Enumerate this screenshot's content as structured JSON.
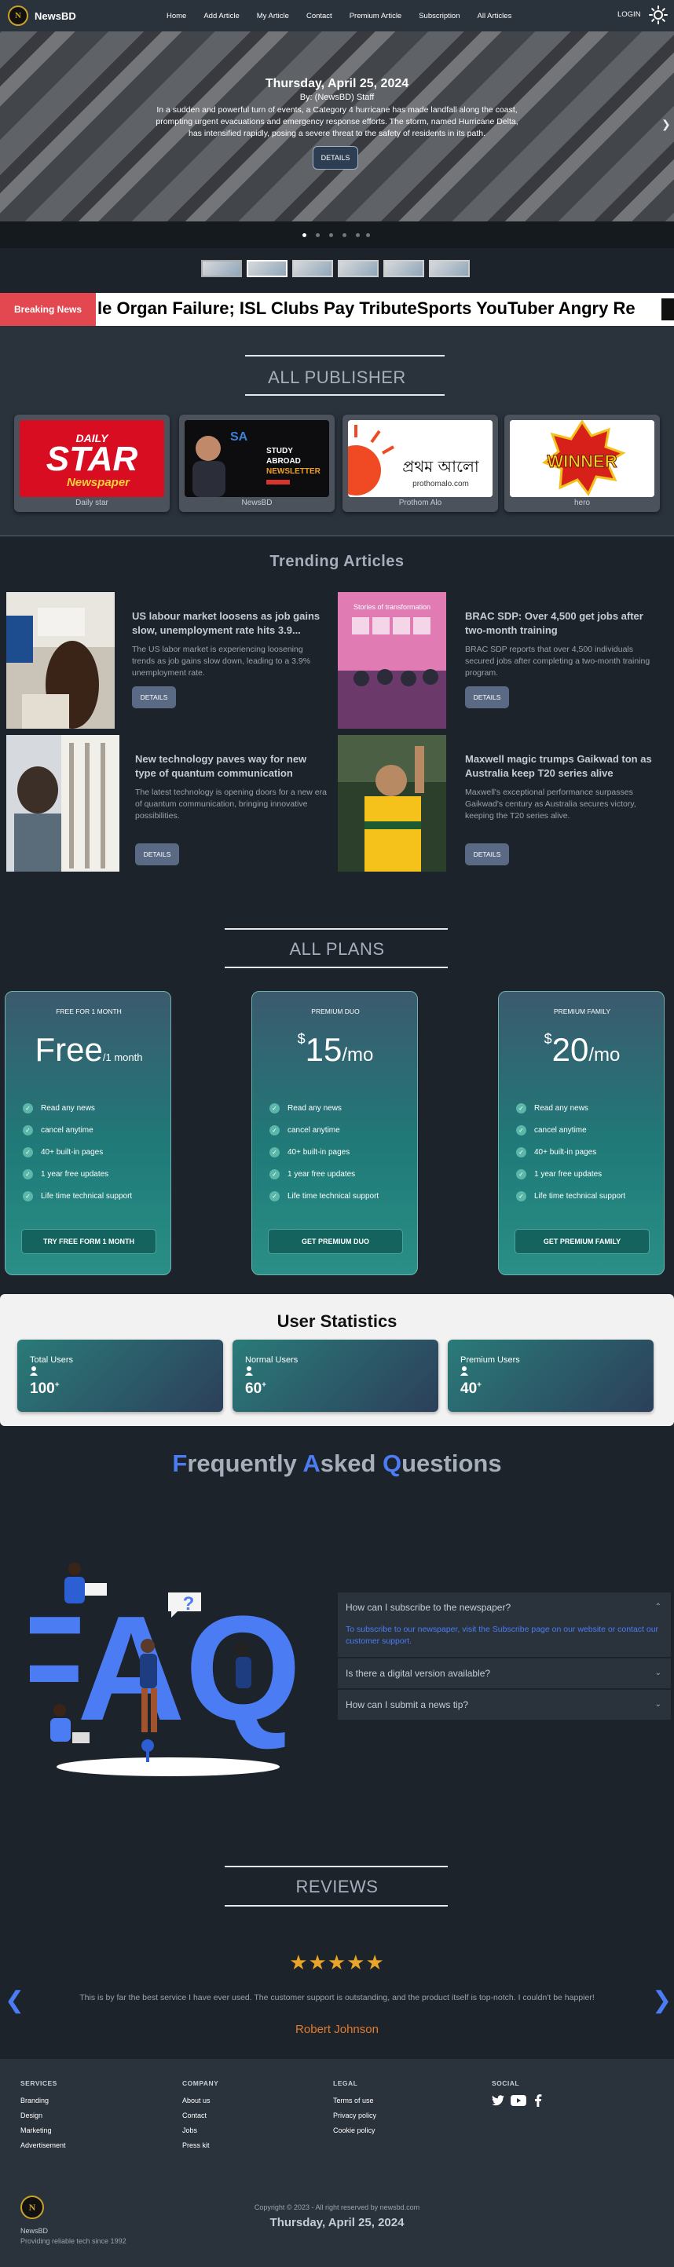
{
  "nav": {
    "logo_letter": "N",
    "brand": "NewsBD",
    "links": [
      "Home",
      "Add Article",
      "My Article",
      "Contact",
      "Premium Article",
      "Subscription",
      "All Articles"
    ],
    "login": "LOGIN",
    "theme_icon": "sun-icon"
  },
  "hero": {
    "date": "Thursday, April 25, 2024",
    "byline": "By: (NewsBD) Staff",
    "text": "In a sudden and powerful turn of events, a Category 4 hurricane has made landfall along the coast, prompting urgent evacuations and emergency response efforts. The storm, named Hurricane Delta, has intensified rapidly, posing a severe threat to the safety of residents in its path.",
    "details_button": "DETAILS",
    "next_icon": "chevron-right-icon",
    "slide_count": 6,
    "active_slide": 1
  },
  "breaking": {
    "label": "Breaking News",
    "ticker": "le Organ Failure; ISL Clubs Pay TributeSports YouTuber Angry Re"
  },
  "publishers": {
    "title": "ALL PUBLISHER",
    "items": [
      {
        "name": "Daily star",
        "logo_top": "DAILY",
        "logo_main": "STAR",
        "logo_sub": "Newspaper"
      },
      {
        "name": "NewsBD",
        "logo_lines": [
          "STUDY",
          "ABROAD",
          "NEWSLETTER"
        ],
        "logo_badge": "SA"
      },
      {
        "name": "Prothom Alo",
        "logo_main": "প্রথম আলো",
        "logo_sub": "prothomalo.com"
      },
      {
        "name": "hero",
        "logo_main": "WINNER"
      }
    ]
  },
  "trending": {
    "title": "Trending Articles",
    "details_label": "DETAILS",
    "articles": [
      {
        "title": "US labour market loosens as job gains slow, unemployment rate hits 3.9...",
        "desc": "The US labor market is experiencing loosening trends as job gains slow down, leading to a 3.9% unemployment rate."
      },
      {
        "title": "BRAC SDP: Over 4,500 get jobs after two-month training",
        "desc": "BRAC SDP reports that over 4,500 individuals secured jobs after completing a two-month training program.",
        "image_caption": "Stories of transformation"
      },
      {
        "title": "New technology paves way for new type of quantum communication",
        "desc": "The latest technology is opening doors for a new era of quantum communication, bringing innovative possibilities."
      },
      {
        "title": "Maxwell magic trumps Gaikwad ton as Australia keep T20 series alive",
        "desc": "Maxwell's exceptional performance surpasses Gaikwad's century as Australia secures victory, keeping the T20 series alive."
      }
    ]
  },
  "plans": {
    "title": "ALL PLANS",
    "features": [
      "Read any news",
      "cancel anytime",
      "40+ built-in pages",
      "1 year free updates",
      "Life time technical support"
    ],
    "items": [
      {
        "name": "FREE FOR 1 MONTH",
        "price_main": "Free",
        "price_suffix": "/1 month",
        "currency": "",
        "button": "TRY FREE FORM 1 MONTH"
      },
      {
        "name": "PREMIUM DUO",
        "currency": "$",
        "price_main": "15",
        "price_suffix": "/mo",
        "button": "GET PREMIUM DUO"
      },
      {
        "name": "PREMIUM FAMILY",
        "currency": "$",
        "price_main": "20",
        "price_suffix": "/mo",
        "button": "GET PREMIUM FAMILY"
      }
    ]
  },
  "stats": {
    "title": "User Statistics",
    "items": [
      {
        "label": "Total Users",
        "value": "100",
        "suffix": "+"
      },
      {
        "label": "Normal Users",
        "value": "60",
        "suffix": "+"
      },
      {
        "label": "Premium Users",
        "value": "40",
        "suffix": "+"
      }
    ]
  },
  "faq": {
    "title_parts": [
      {
        "b": "F",
        "r": "requently "
      },
      {
        "b": "A",
        "r": "sked "
      },
      {
        "b": "Q",
        "r": "uestions"
      }
    ],
    "illustration_text": "FAQ",
    "items": [
      {
        "q": "How can I subscribe to the newspaper?",
        "a": "To subscribe to our newspaper, visit the Subscribe page on our website or contact our customer support.",
        "open": true
      },
      {
        "q": "Is there a digital version available?",
        "open": false
      },
      {
        "q": "How can I submit a news tip?",
        "open": false
      }
    ]
  },
  "reviews": {
    "title": "REVIEWS",
    "stars": 5,
    "text": "This is by far the best service I have ever used. The customer support is outstanding, and the product itself is top-notch. I couldn't be happier!",
    "author": "Robert Johnson"
  },
  "footer": {
    "columns": [
      {
        "heading": "SERVICES",
        "links": [
          "Branding",
          "Design",
          "Marketing",
          "Advertisement"
        ]
      },
      {
        "heading": "COMPANY",
        "links": [
          "About us",
          "Contact",
          "Jobs",
          "Press kit"
        ]
      },
      {
        "heading": "LEGAL",
        "links": [
          "Terms of use",
          "Privacy policy",
          "Cookie policy"
        ]
      },
      {
        "heading": "SOCIAL",
        "icons": [
          "twitter-icon",
          "youtube-icon",
          "facebook-icon"
        ]
      }
    ],
    "brand": "NewsBD",
    "tagline": "Providing reliable tech since 1992",
    "copyright": "Copyright © 2023 - All right reserved by newsbd.com",
    "date": "Thursday, April 25, 2024"
  }
}
